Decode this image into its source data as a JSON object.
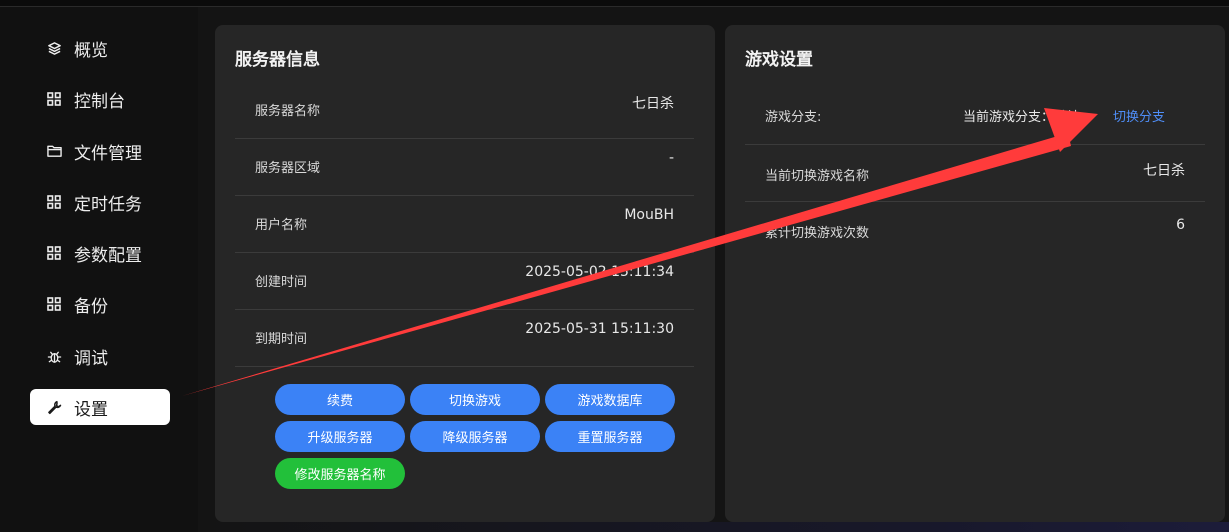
{
  "sidebar": {
    "items": [
      {
        "label": "概览",
        "icon": "layers-icon"
      },
      {
        "label": "控制台",
        "icon": "grid-icon"
      },
      {
        "label": "文件管理",
        "icon": "folder-icon"
      },
      {
        "label": "定时任务",
        "icon": "grid-icon"
      },
      {
        "label": "参数配置",
        "icon": "grid-icon"
      },
      {
        "label": "备份",
        "icon": "grid-icon"
      },
      {
        "label": "调试",
        "icon": "bug-icon"
      },
      {
        "label": "设置",
        "icon": "wrench-icon",
        "active": true
      }
    ]
  },
  "server_info": {
    "title": "服务器信息",
    "rows": [
      {
        "label": "服务器名称",
        "value": "七日杀"
      },
      {
        "label": "服务器区域",
        "value": "-"
      },
      {
        "label": "用户名称",
        "value": "MouBH"
      },
      {
        "label": "创建时间",
        "value": "2025-05-02 15:11:34"
      },
      {
        "label": "到期时间",
        "value": "2025-05-31 15:11:30"
      }
    ],
    "buttons": {
      "renew": "续费",
      "switch_game": "切换游戏",
      "game_database": "游戏数据库",
      "upgrade": "升级服务器",
      "downgrade": "降级服务器",
      "reset": "重置服务器",
      "rename": "修改服务器名称"
    }
  },
  "game_settings": {
    "title": "游戏设置",
    "branch_label": "游戏分支:",
    "branch_current": "当前游戏分支：默认",
    "switch_branch": "切换分支",
    "current_game_label": "当前切换游戏名称",
    "current_game_value": "七日杀",
    "switch_count_label": "累计切换游戏次数",
    "switch_count_value": "6"
  },
  "colors": {
    "accent_blue": "#3b82f6",
    "accent_green": "#22c03a",
    "arrow_red": "#ff3b3b",
    "link_blue": "#4f8ef7"
  }
}
